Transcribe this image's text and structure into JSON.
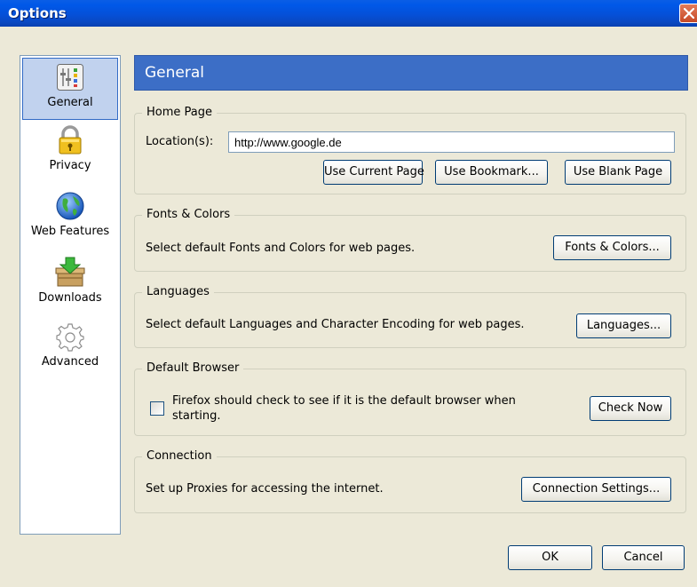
{
  "window": {
    "title": "Options"
  },
  "sidebar": {
    "items": [
      {
        "label": "General",
        "icon": "general-icon"
      },
      {
        "label": "Privacy",
        "icon": "lock-icon"
      },
      {
        "label": "Web Features",
        "icon": "globe-icon"
      },
      {
        "label": "Downloads",
        "icon": "download-box-icon"
      },
      {
        "label": "Advanced",
        "icon": "gear-icon"
      }
    ],
    "selected": "General"
  },
  "header": {
    "title": "General"
  },
  "home_page": {
    "title": "Home Page",
    "location_label": "Location(s):",
    "location_value": "http://www.google.de",
    "use_current_label": "Use Current Page",
    "use_bookmark_label": "Use Bookmark...",
    "use_blank_label": "Use Blank Page"
  },
  "fonts_colors": {
    "title": "Fonts & Colors",
    "description": "Select default Fonts and Colors for web pages.",
    "button_label": "Fonts & Colors..."
  },
  "languages": {
    "title": "Languages",
    "description": "Select default Languages and Character Encoding for web pages.",
    "button_label": "Languages..."
  },
  "default_browser": {
    "title": "Default Browser",
    "check_label": "Firefox should check to see if it is the default browser when starting.",
    "checked": false,
    "button_label": "Check Now"
  },
  "connection": {
    "title": "Connection",
    "description": "Set up Proxies for accessing the internet.",
    "button_label": "Connection Settings..."
  },
  "footer": {
    "ok_label": "OK",
    "cancel_label": "Cancel"
  },
  "colors": {
    "titlebar": "#0058e8",
    "header_bg": "#3c6ec6",
    "selected_bg": "#c1d2ee",
    "dialog_bg": "#ece9d8"
  }
}
